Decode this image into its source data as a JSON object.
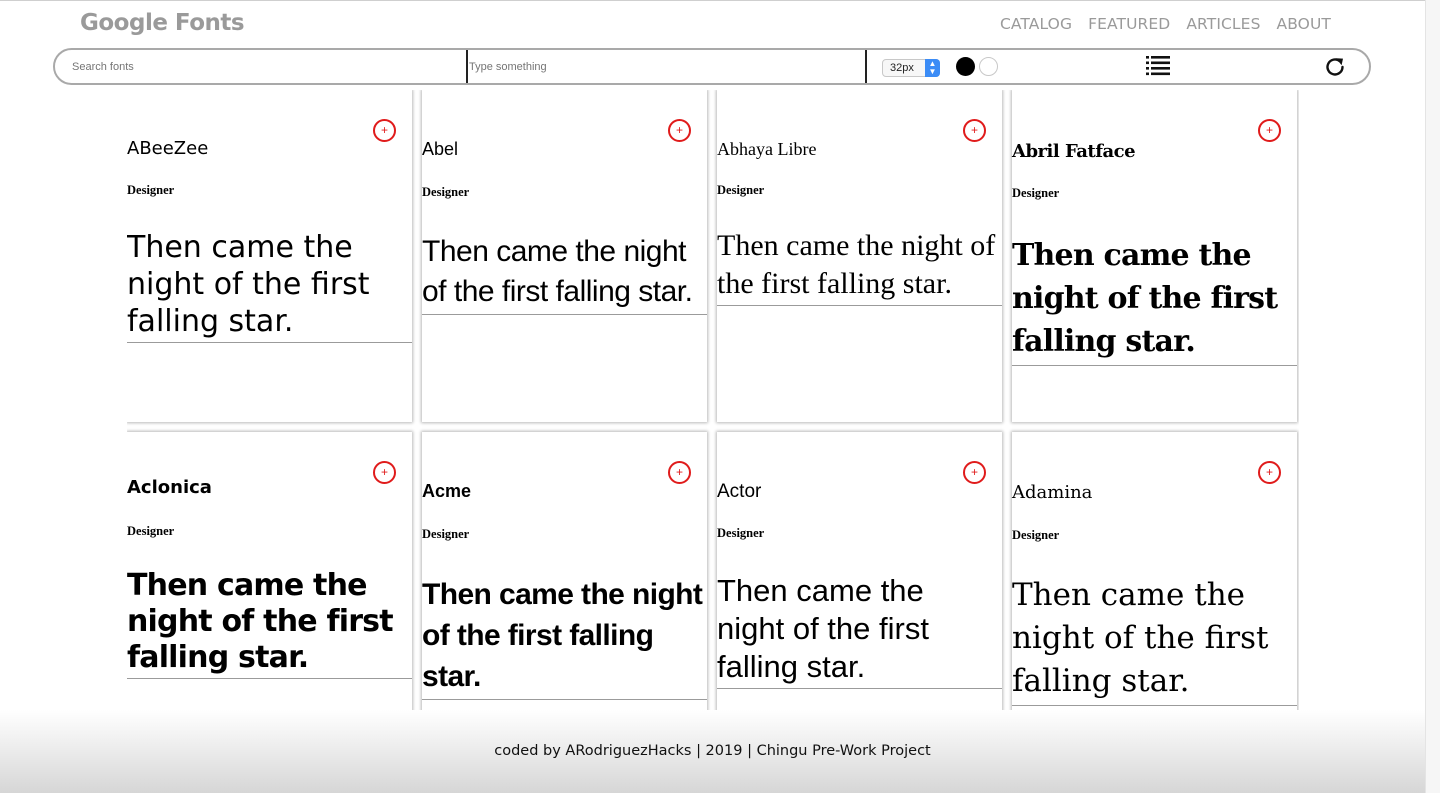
{
  "header": {
    "logo": "Google Fonts",
    "nav": [
      "CATALOG",
      "FEATURED",
      "ARTICLES",
      "ABOUT"
    ]
  },
  "toolbar": {
    "search_placeholder": "Search fonts",
    "sample_placeholder": "Type something",
    "font_size": "32px",
    "theme_colors": [
      "#000000",
      "#ffffff"
    ],
    "list_icon": "list-icon",
    "refresh_icon": "refresh-icon"
  },
  "cards": [
    {
      "name": "ABeeZee",
      "designer": "Designer",
      "sample": "Then came the night of the first falling star.",
      "add": "+"
    },
    {
      "name": "Abel",
      "designer": "Designer",
      "sample": "Then came the night of the first falling star.",
      "add": "+"
    },
    {
      "name": "Abhaya Libre",
      "designer": "Designer",
      "sample": "Then came the night of the first falling star.",
      "add": "+"
    },
    {
      "name": "Abril Fatface",
      "designer": "Designer",
      "sample": "Then came the night of the first falling star.",
      "add": "+"
    },
    {
      "name": "Aclonica",
      "designer": "Designer",
      "sample": "Then came the night of the first falling star.",
      "add": "+"
    },
    {
      "name": "Acme",
      "designer": "Designer",
      "sample": "Then came the night of the first falling star.",
      "add": "+"
    },
    {
      "name": "Actor",
      "designer": "Designer",
      "sample": "Then came the night of the first falling star.",
      "add": "+"
    },
    {
      "name": "Adamina",
      "designer": "Designer",
      "sample": "Then came the night of the first falling star.",
      "add": "+"
    }
  ],
  "accent_color": "#e01b1b",
  "footer": {
    "text": "coded by ARodriguezHacks | 2019 | Chingu Pre-Work Project"
  }
}
